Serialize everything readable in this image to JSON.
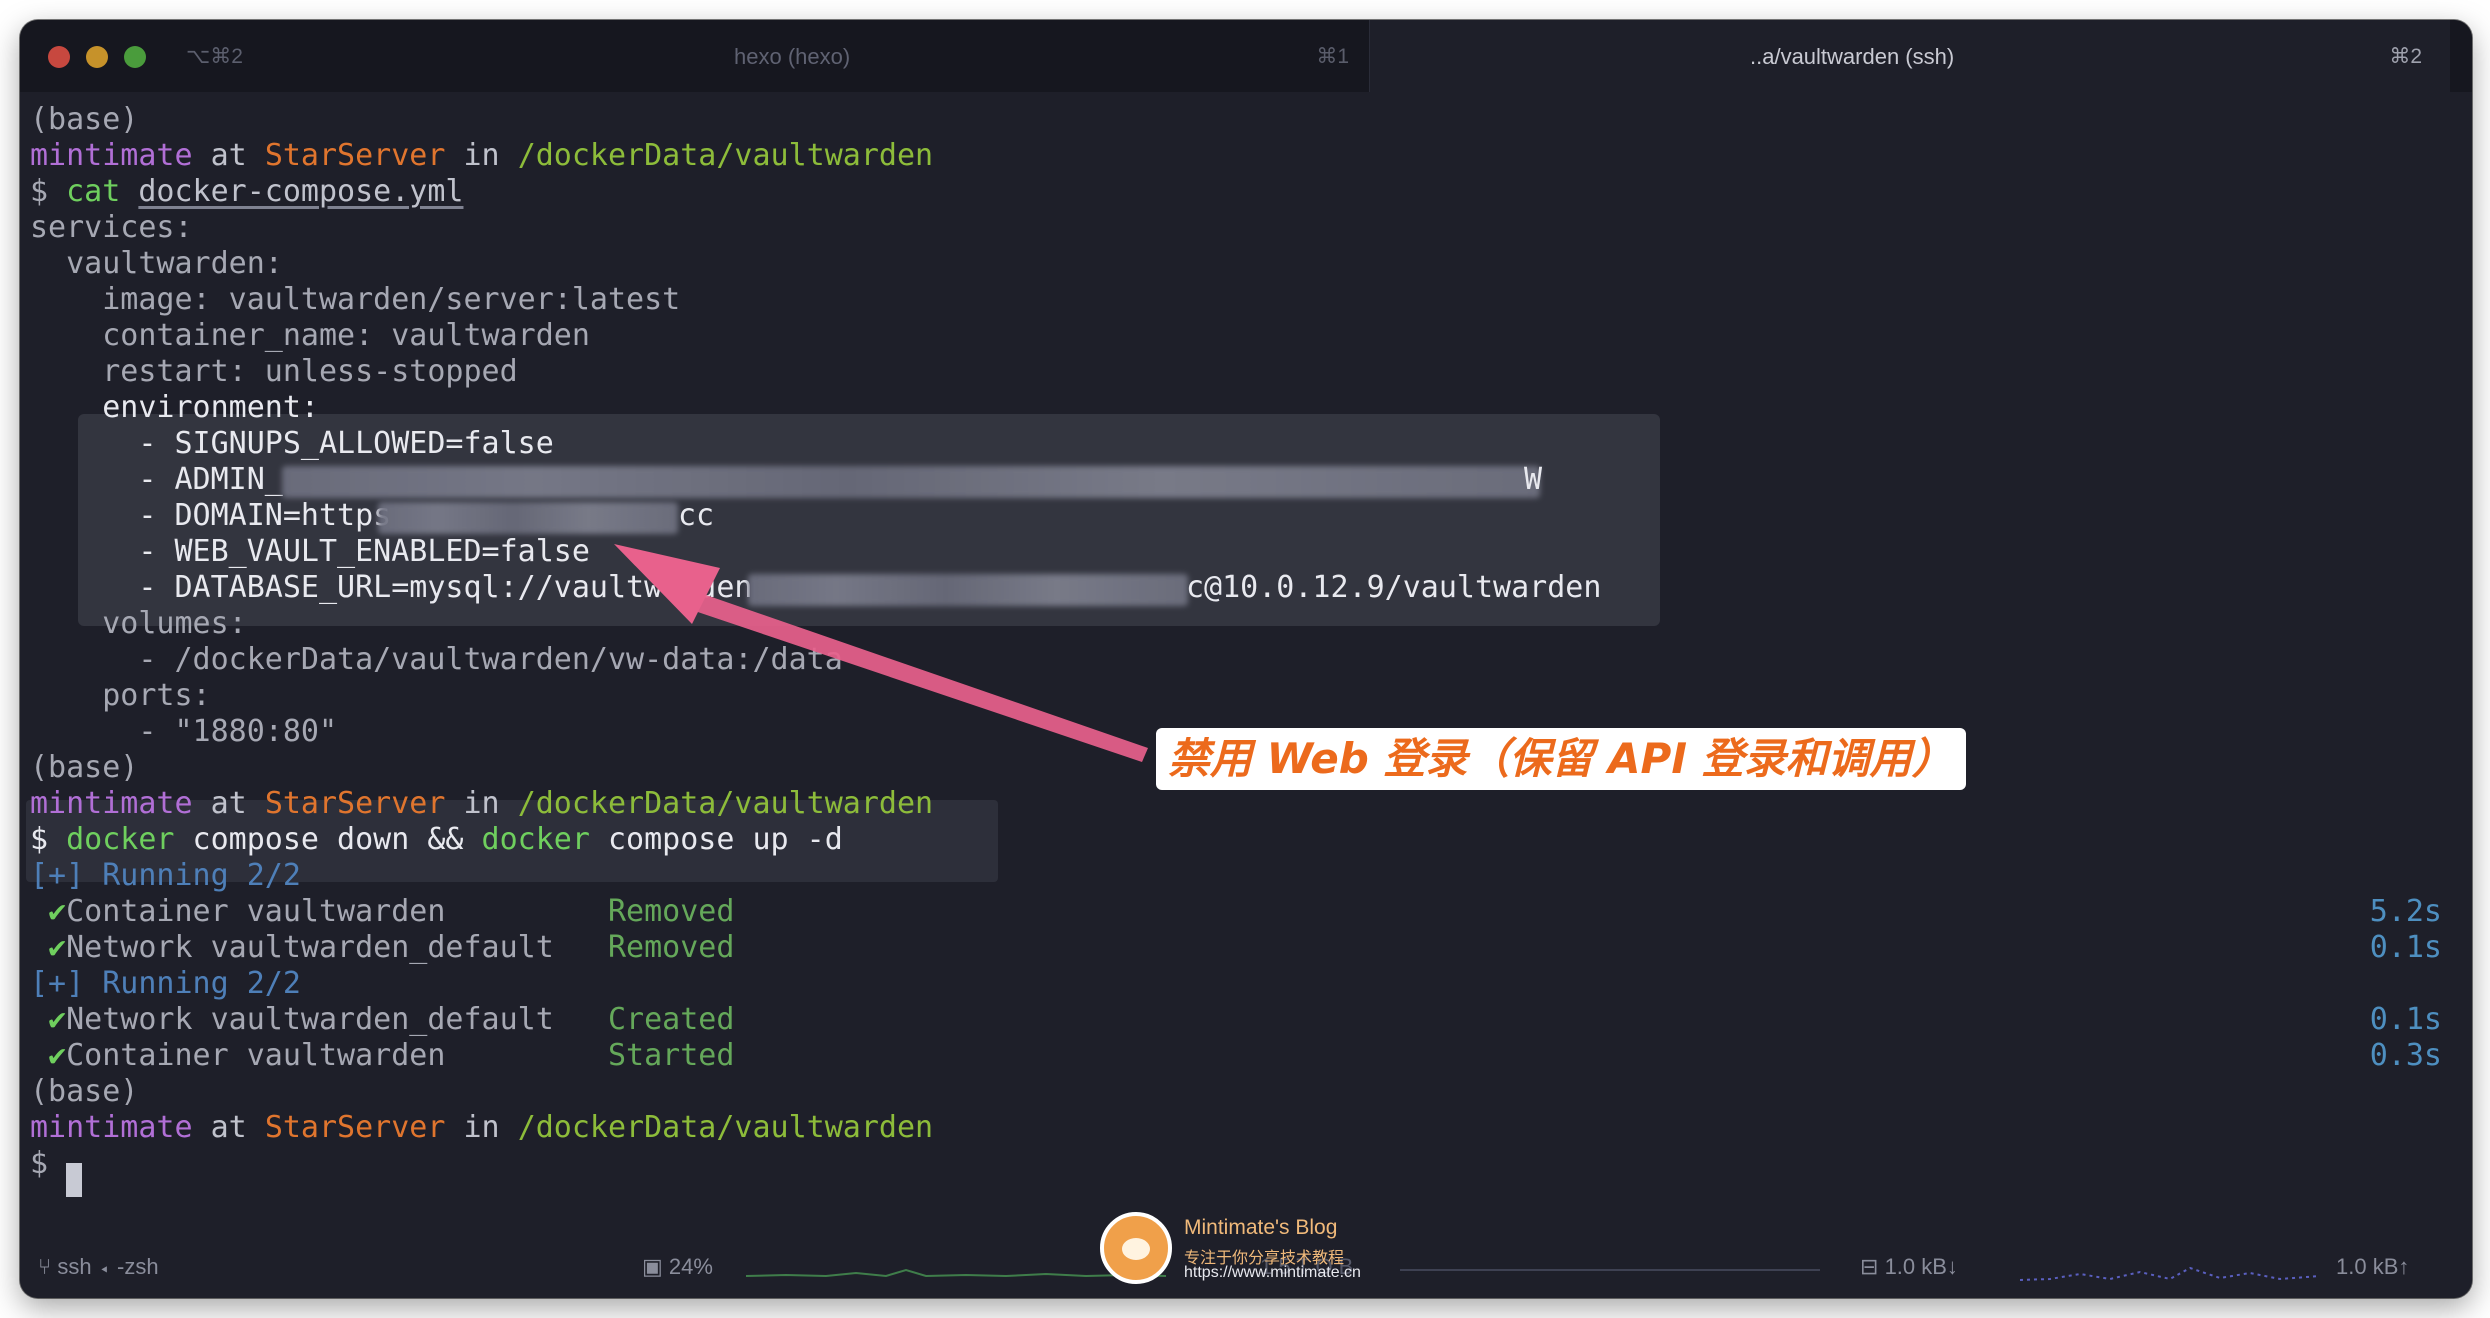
{
  "tabs": {
    "new_tab_shortcut": "⌥⌘2",
    "items": [
      {
        "title": "hexo (hexo)",
        "shortcut": "⌘1"
      },
      {
        "title": "..a/vaultwarden (ssh)",
        "shortcut": "⌘2"
      }
    ]
  },
  "terminal": {
    "base": "(base)",
    "prompt": {
      "user": "mintimate",
      "at": "at",
      "host": "StarServer",
      "in": "in",
      "path": "/dockerData/vaultwarden",
      "symbol": "$"
    },
    "cmd1": {
      "cmd": "cat",
      "arg": "docker-compose.yml"
    },
    "yaml": [
      "services:",
      "  vaultwarden:",
      "    image: vaultwarden/server:latest",
      "    container_name: vaultwarden",
      "    restart: unless-stopped",
      "    environment:",
      "      - SIGNUPS_ALLOWED=false",
      "      - ADMIN_",
      "      - DOMAIN=https",
      "      - WEB_VAULT_ENABLED=false",
      "      - DATABASE_URL=mysql://vaultwarden",
      "    volumes:",
      "      - /dockerData/vaultwarden/vw-data:/data",
      "    ports:",
      "      - \"1880:80\""
    ],
    "redacted_tails": {
      "admin": "W",
      "domain": "cc",
      "database": "c@10.0.12.9/vaultwarden"
    },
    "cmd2": {
      "docker1": "docker",
      "mid": " compose down && ",
      "docker2": "docker",
      "end": " compose up -d"
    },
    "output": [
      {
        "kind": "header",
        "text": "[+] Running 2/2"
      },
      {
        "kind": "row",
        "check": "✔",
        "name": "Container vaultwarden       ",
        "status": "Removed",
        "time": "5.2s"
      },
      {
        "kind": "row",
        "check": "✔",
        "name": "Network vaultwarden_default ",
        "status": "Removed",
        "time": "0.1s"
      },
      {
        "kind": "header",
        "text": "[+] Running 2/2"
      },
      {
        "kind": "row",
        "check": "✔",
        "name": "Network vaultwarden_default ",
        "status": "Created",
        "time": "0.1s"
      },
      {
        "kind": "row",
        "check": "✔",
        "name": "Container vaultwarden       ",
        "status": "Started",
        "time": "0.3s"
      }
    ]
  },
  "annotation": {
    "text": "禁用 Web 登录（保留 API 登录和调用）",
    "color": "#ec6a1c"
  },
  "statusbar": {
    "session": "ssh ◂ -zsh",
    "cpu": "24%",
    "net_down": "1.0 kB↓",
    "net_up": "1.0 kB↑",
    "partial_label": "1 5 T O B"
  },
  "watermark": {
    "title": "Mintimate's Blog",
    "subtitle": "专注于你分享技术教程",
    "url": "https://www.mintimate.cn"
  },
  "colors": {
    "background": "#1e1f29",
    "user": "#b16fd6",
    "host": "#e0752e",
    "path": "#8dbc3a",
    "command": "#6fcf5e"
  }
}
